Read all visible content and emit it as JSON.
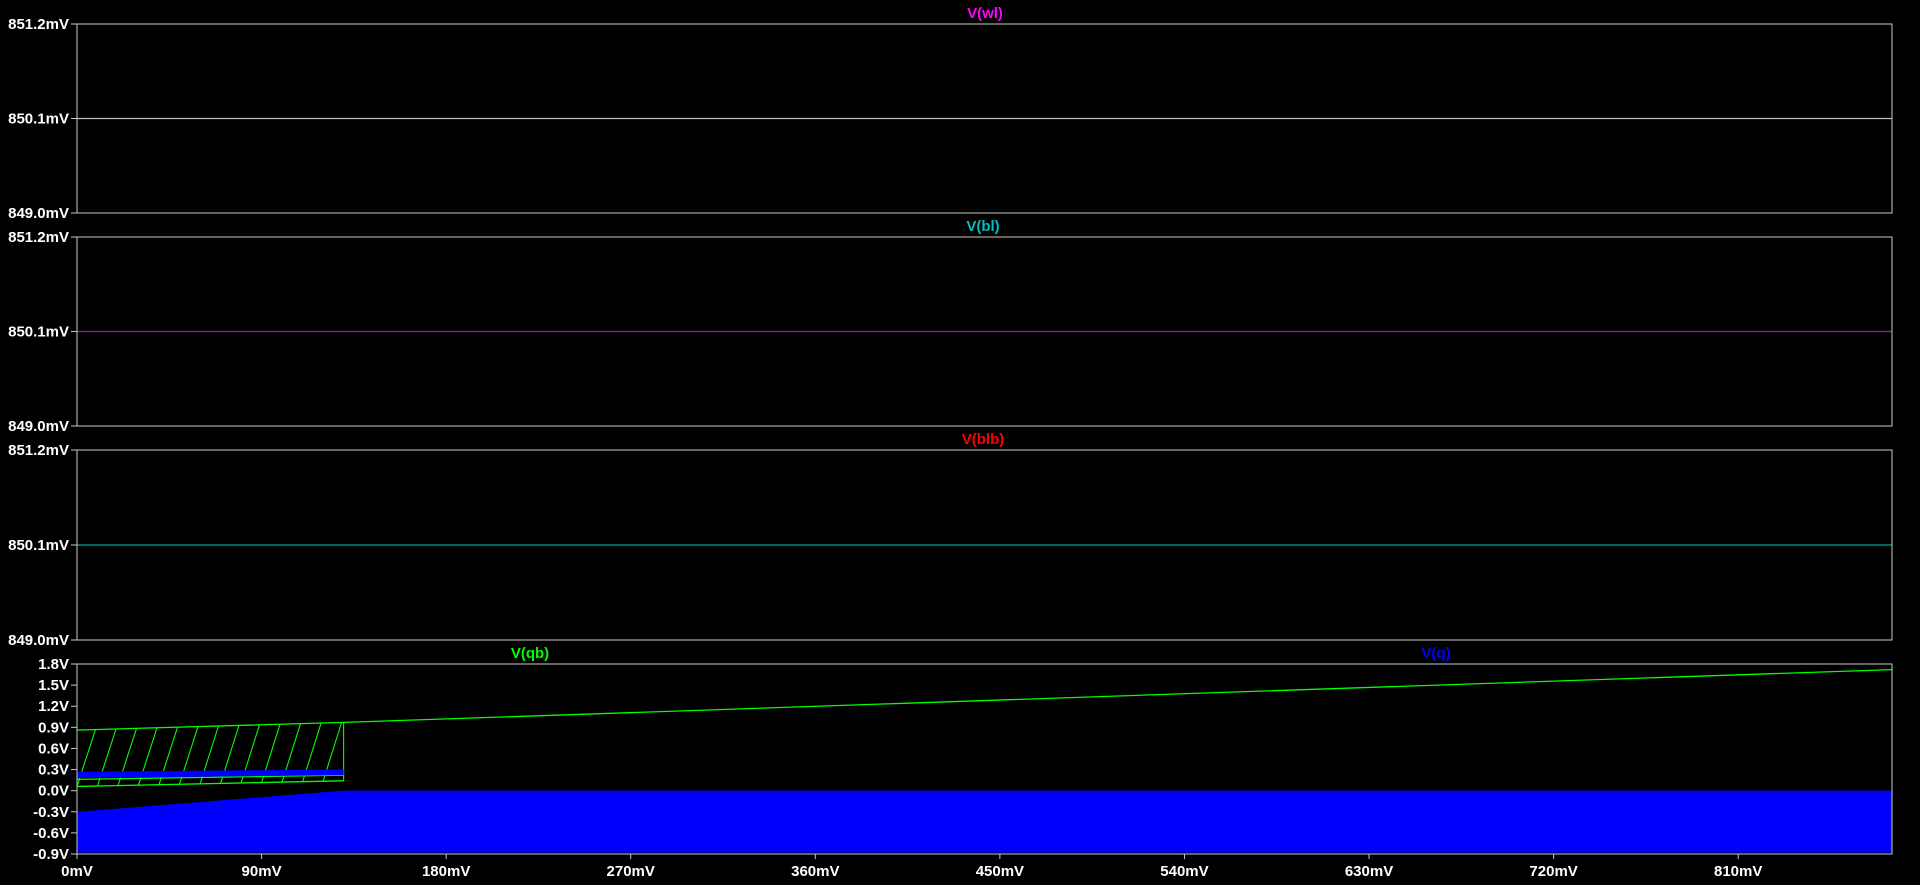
{
  "chart_data": [
    {
      "type": "line",
      "title": "",
      "series": [
        {
          "name": "V(wl)",
          "color": "#ff00ff",
          "trace_color": "#c0c0c0",
          "points": [
            [
              0,
              850.1
            ],
            [
              885,
              850.1
            ]
          ]
        }
      ],
      "xlim": [
        0,
        885
      ],
      "ylim": [
        849.0,
        851.2
      ],
      "yticks": [
        851.2,
        850.1,
        849.0
      ],
      "ytick_labels": [
        "851.2mV",
        "850.1mV",
        "849.0mV"
      ],
      "grid": false
    },
    {
      "type": "line",
      "title": "",
      "series": [
        {
          "name": "V(bl)",
          "color": "#00c0c0",
          "trace_color": "#c000c0",
          "points": [
            [
              0,
              850.1
            ],
            [
              885,
              850.1
            ]
          ]
        }
      ],
      "xlim": [
        0,
        885
      ],
      "ylim": [
        849.0,
        851.2
      ],
      "yticks": [
        851.2,
        850.1,
        849.0
      ],
      "ytick_labels": [
        "851.2mV",
        "850.1mV",
        "849.0mV"
      ],
      "grid": false
    },
    {
      "type": "line",
      "title": "",
      "series": [
        {
          "name": "V(blb)",
          "color": "#ff0000",
          "trace_color": "#00a0a0",
          "points": [
            [
              0,
              850.1
            ],
            [
              885,
              850.1
            ]
          ]
        }
      ],
      "xlim": [
        0,
        885
      ],
      "ylim": [
        849.0,
        851.2
      ],
      "yticks": [
        851.2,
        850.1,
        849.0
      ],
      "ytick_labels": [
        "851.2mV",
        "850.1mV",
        "849.0mV"
      ],
      "grid": false
    },
    {
      "type": "line",
      "title": "",
      "series": [
        {
          "name": "V(qb)",
          "color": "#00ff00",
          "points": [
            [
              0,
              0.86
            ],
            [
              130,
              0.97
            ],
            [
              885,
              1.72
            ]
          ],
          "osc_band": {
            "x_start": 0,
            "x_end": 130,
            "low": [
              0.06,
              0.14
            ],
            "high": [
              0.16,
              0.22
            ],
            "count": 13
          }
        },
        {
          "name": "V(q)",
          "color": "#0000ff",
          "fill_band": {
            "x_start": 0,
            "x_knee": 130,
            "x_end": 885,
            "top": 0.0,
            "bottom_start": -0.3,
            "bottom_knee": 0.0,
            "bottom": -0.88
          },
          "osc_band": {
            "x_start": 0,
            "x_end": 130,
            "low": [
              0.18,
              0.22
            ],
            "high": [
              0.27,
              0.3
            ]
          }
        }
      ],
      "xlim": [
        0,
        885
      ],
      "ylim": [
        -0.9,
        1.8
      ],
      "yticks": [
        1.8,
        1.5,
        1.2,
        0.9,
        0.6,
        0.3,
        0.0,
        -0.3,
        -0.6,
        -0.9
      ],
      "ytick_labels": [
        "1.8V",
        "1.5V",
        "1.2V",
        "0.9V",
        "0.6V",
        "0.3V",
        "0.0V",
        "-0.3V",
        "-0.6V",
        "-0.9V"
      ],
      "xticks": [
        0,
        90,
        180,
        270,
        360,
        450,
        540,
        630,
        720,
        810
      ],
      "xtick_labels": [
        "0mV",
        "90mV",
        "180mV",
        "270mV",
        "360mV",
        "450mV",
        "540mV",
        "630mV",
        "720mV",
        "810mV"
      ],
      "grid": false
    }
  ],
  "colors": {
    "background": "#000000",
    "frame": "#c8c8c8",
    "text": "#ffffff"
  }
}
